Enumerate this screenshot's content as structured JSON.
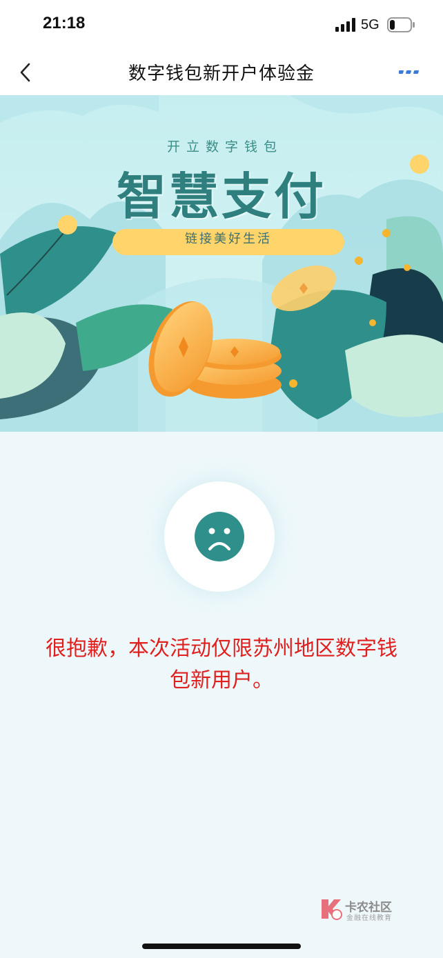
{
  "status_bar": {
    "time": "21:18",
    "network": "5G",
    "battery_level": 0.2
  },
  "nav": {
    "title": "数字钱包新开户体验金",
    "back_icon": "chevron-left-icon",
    "more_icon": "more-dots-icon"
  },
  "banner": {
    "subtitle": "开立数字钱包",
    "title": "智慧支付",
    "tagline": "链接美好生活"
  },
  "result": {
    "icon": "sad-face-icon",
    "message": "很抱歉，本次活动仅限苏州地区数字钱包新用户。"
  },
  "watermark": {
    "name": "卡农社区",
    "sub": "金融在线教育"
  },
  "colors": {
    "accent": "#3a7bd5",
    "error": "#e0201f",
    "teal": "#2f8f8a",
    "pill": "#ffd56b"
  }
}
